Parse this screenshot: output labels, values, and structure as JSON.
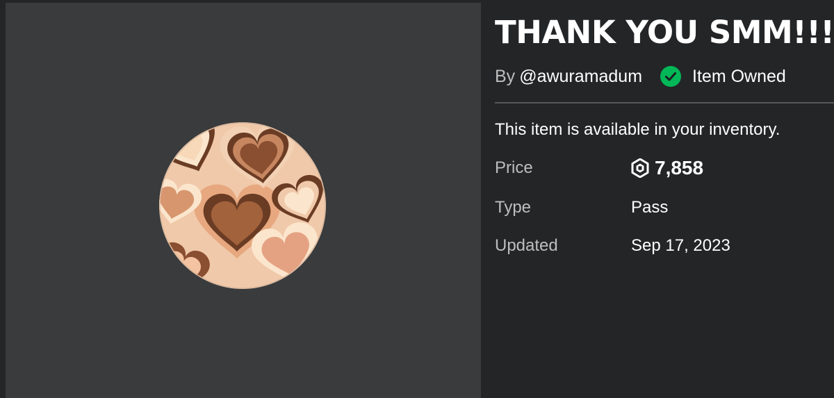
{
  "item": {
    "title": "THANK YOU SMM!!!",
    "by_prefix": "By",
    "creator": "@awuramadum",
    "owned_label": "Item Owned",
    "availability": "This item is available in your inventory."
  },
  "details": {
    "price_label": "Price",
    "price_value": "7,858",
    "type_label": "Type",
    "type_value": "Pass",
    "updated_label": "Updated",
    "updated_value": "Sep 17, 2023"
  },
  "icons": {
    "owned": "check-circle-icon",
    "currency": "robux-icon"
  },
  "colors": {
    "background": "#232527",
    "thumbnail_panel": "#393b3d",
    "owned_green": "#02b757",
    "muted_text": "#bdbebe"
  }
}
